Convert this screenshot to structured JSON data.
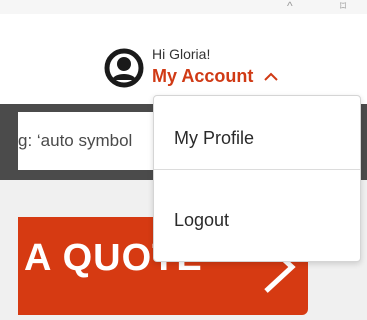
{
  "header": {
    "greeting": "Hi Gloria!",
    "account_label": "My Account",
    "accent_color": "#d03a15"
  },
  "search": {
    "text": "g: ‘auto symbol"
  },
  "account_menu": {
    "items": [
      {
        "label": "My Profile"
      },
      {
        "label": "Logout"
      }
    ]
  },
  "quote_button": {
    "label": "A QUOTE",
    "color": "#d63a12"
  },
  "icons": {
    "avatar": "user-circle-icon",
    "account_chevron": "chevron-up-icon",
    "quote_chevron": "chevron-right-icon"
  }
}
